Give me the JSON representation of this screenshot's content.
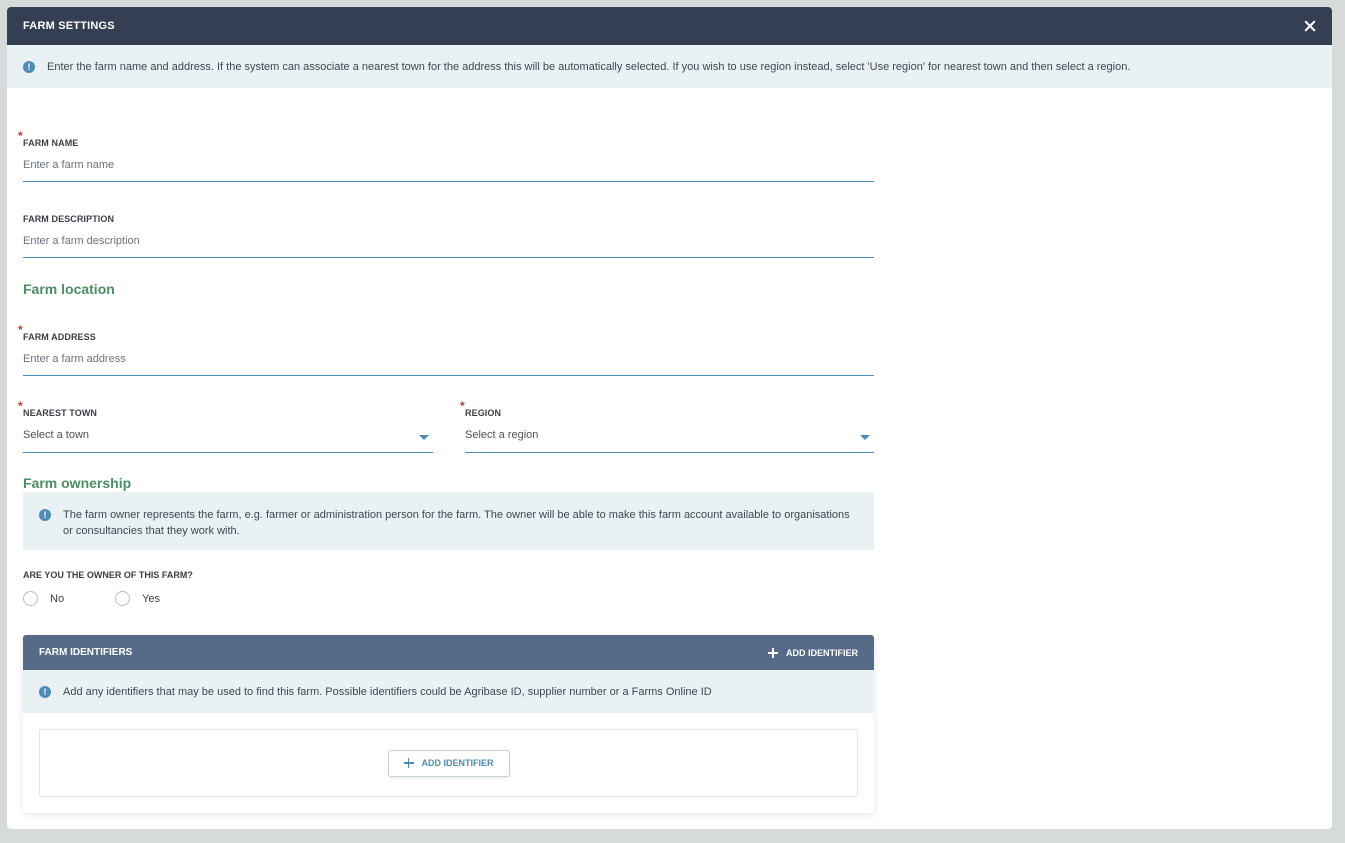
{
  "modal": {
    "title": "FARM SETTINGS",
    "info": "Enter the farm name and address. If the system can associate a nearest town for the address this will be automatically selected. If you wish to use region instead, select 'Use region' for nearest town and then select a region."
  },
  "fields": {
    "farm_name": {
      "label": "FARM NAME",
      "placeholder": "Enter a farm name",
      "required": "*"
    },
    "farm_description": {
      "label": "FARM DESCRIPTION",
      "placeholder": "Enter a farm description"
    },
    "farm_address": {
      "label": "FARM ADDRESS",
      "placeholder": "Enter a farm address",
      "required": "*"
    },
    "nearest_town": {
      "label": "NEAREST TOWN",
      "value": "Select a town",
      "required": "*"
    },
    "region": {
      "label": "REGION",
      "value": "Select a region",
      "required": "*"
    }
  },
  "sections": {
    "location": "Farm location",
    "ownership": "Farm ownership"
  },
  "ownership": {
    "info": "The farm owner represents the farm, e.g. farmer or administration person for the farm. The owner will be able to make this farm account available to organisations or consultancies that they work with.",
    "question": "ARE YOU THE OWNER OF THIS FARM?",
    "options": [
      "No",
      "Yes"
    ]
  },
  "identifiers": {
    "title": "FARM IDENTIFIERS",
    "header_add_label": "ADD IDENTIFIER",
    "info": "Add any identifiers that may be used to find this farm. Possible identifiers could be Agribase ID, supplier number or a Farms Online ID",
    "add_label": "ADD IDENTIFIER"
  },
  "colors": {
    "header_bg": "#353f53",
    "accent_blue": "#4d8db5",
    "section_green": "#4a9063",
    "identifiers_header_bg": "#556b88",
    "info_bg": "#eaf1f4",
    "required_red": "#c0392b"
  }
}
